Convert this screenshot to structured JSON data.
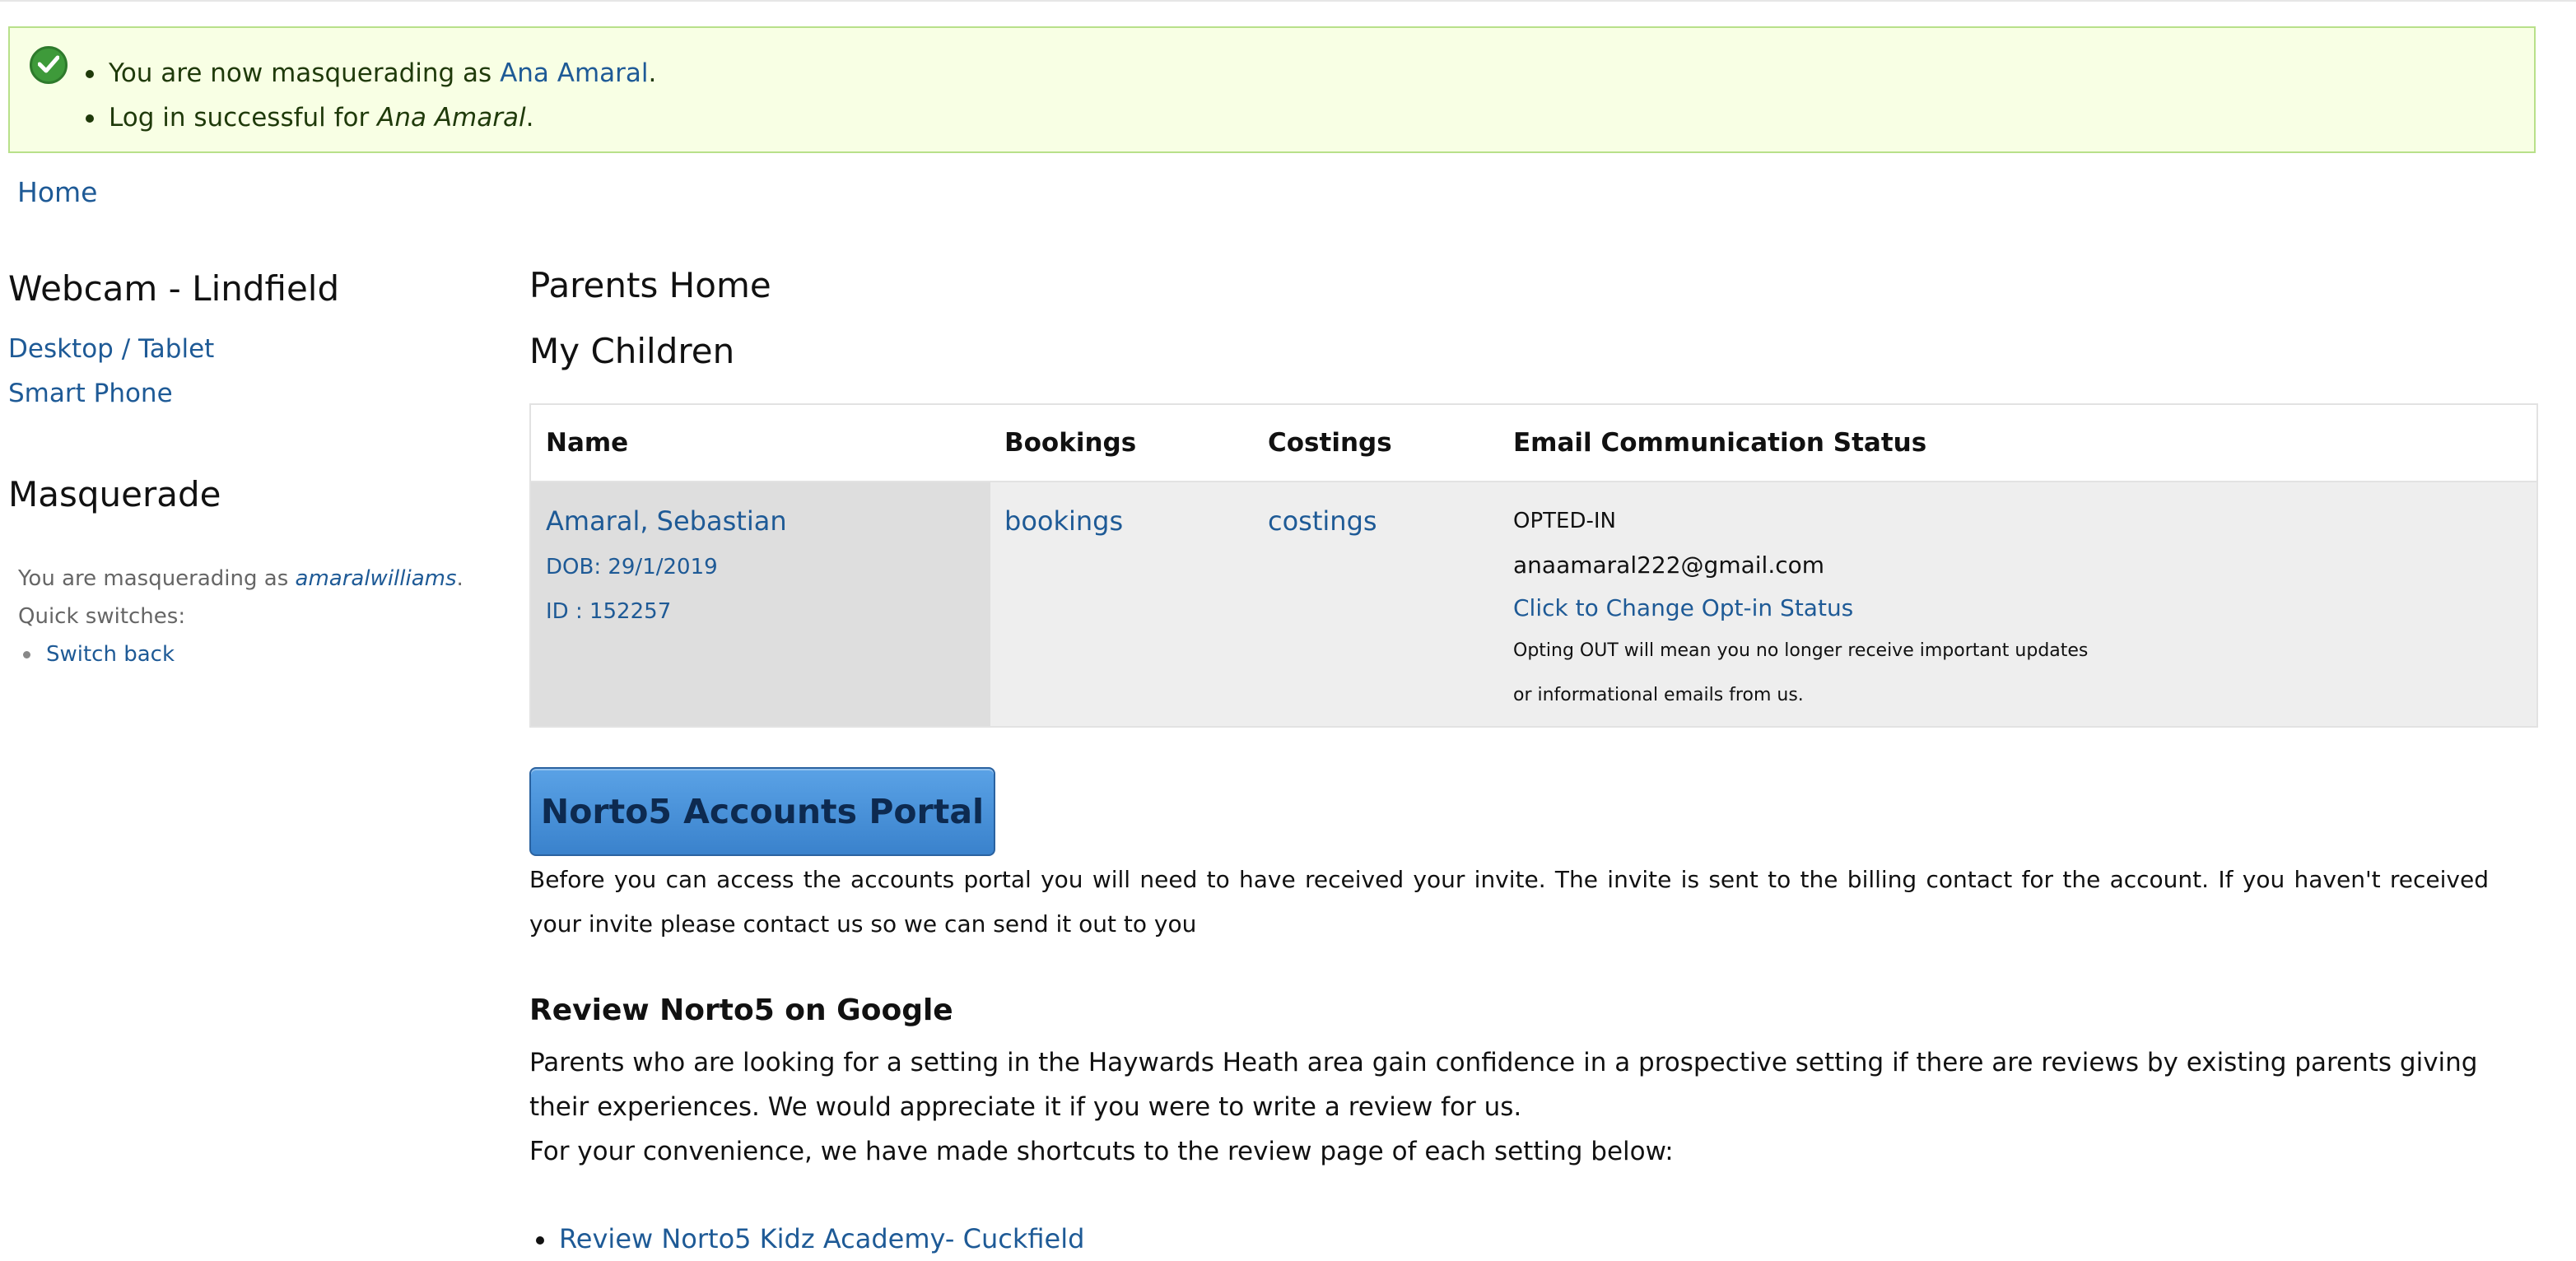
{
  "messages": {
    "masquerade_prefix": "You are now masquerading as ",
    "masquerade_user": "Ana Amaral",
    "masquerade_suffix": ".",
    "login_prefix": "Log in successful for ",
    "login_user": "Ana Amaral",
    "login_suffix": "."
  },
  "nav": {
    "home": "Home"
  },
  "sidebar": {
    "webcam_title": "Webcam - Lindfield",
    "desktop_link": "Desktop / Tablet",
    "phone_link": "Smart Phone",
    "masquerade_title": "Masquerade",
    "masq_prefix": "You are masquerading as ",
    "masq_user": "amaralwilliams",
    "masq_suffix": ".",
    "quick_switches": "Quick switches:",
    "switch_back": "Switch back"
  },
  "main": {
    "title": "Parents Home",
    "children_title": "My Children",
    "table": {
      "headers": [
        "Name",
        "Bookings",
        "Costings",
        "Email Communication Status"
      ],
      "rows": [
        {
          "name": "Amaral, Sebastian",
          "dob": "DOB: 29/1/2019",
          "id": "ID : 152257",
          "bookings": "bookings",
          "costings": "costings",
          "status": "OPTED-IN",
          "email": "anaamaral222@gmail.com",
          "change_link": "Click to Change Opt-in Status",
          "note_line1": "Opting OUT will mean you no longer receive important updates",
          "note_line2": "or informational emails from us."
        }
      ]
    },
    "portal_button": "Norto5 Accounts Portal",
    "portal_text": "Before you can access the accounts portal you will need to have received your invite. The invite is sent to the billing contact for the account. If you haven't received your invite please contact us so we can send it out to you",
    "review_title": "Review Norto5 on Google",
    "review_text": "Parents who are looking for a setting in the Haywards Heath area gain confidence in a prospective setting if there are reviews by existing parents giving their experiences. We would appreciate it if you were to write a review for us.",
    "review_shortcuts": "For your convenience, we have made shortcuts to the review page of each setting below:",
    "review_links": [
      "Review Norto5 Kidz Academy- Cuckfield"
    ]
  }
}
